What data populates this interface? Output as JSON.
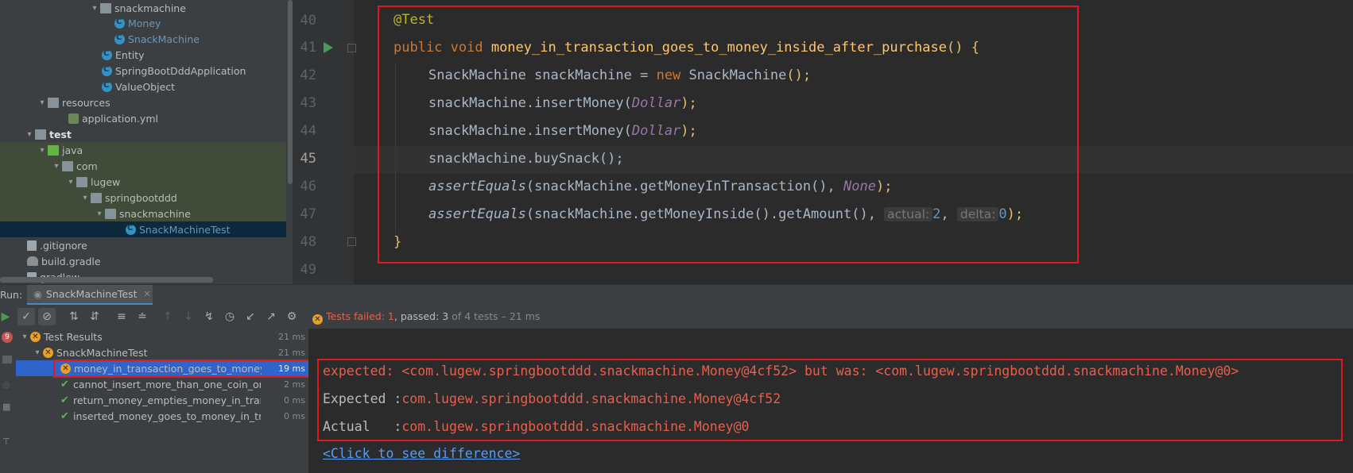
{
  "project_tree": {
    "items": [
      {
        "label": "snackmachine",
        "kind": "folder",
        "arrow": "v"
      },
      {
        "label": "Money",
        "kind": "class",
        "style": "blue"
      },
      {
        "label": "SnackMachine",
        "kind": "class",
        "style": "blue"
      },
      {
        "label": "Entity",
        "kind": "class",
        "style": ""
      },
      {
        "label": "SpringBootDddApplication",
        "kind": "class",
        "style": ""
      },
      {
        "label": "ValueObject",
        "kind": "class",
        "style": ""
      },
      {
        "label": "resources",
        "kind": "folder",
        "arrow": "v"
      },
      {
        "label": "application.yml",
        "kind": "yml",
        "style": ""
      },
      {
        "label": "test",
        "kind": "folder",
        "arrow": "v",
        "style": "bold"
      },
      {
        "label": "java",
        "kind": "folder-green",
        "arrow": "v"
      },
      {
        "label": "com",
        "kind": "folder",
        "arrow": "v"
      },
      {
        "label": "lugew",
        "kind": "folder",
        "arrow": "v"
      },
      {
        "label": "springbootddd",
        "kind": "folder",
        "arrow": "v"
      },
      {
        "label": "snackmachine",
        "kind": "folder",
        "arrow": "v"
      },
      {
        "label": "SnackMachineTest",
        "kind": "class",
        "style": "blue"
      },
      {
        "label": ".gitignore",
        "kind": "file",
        "style": ""
      },
      {
        "label": "build.gradle",
        "kind": "gradle",
        "style": ""
      },
      {
        "label": "gradlew",
        "kind": "file",
        "style": ""
      }
    ]
  },
  "editor": {
    "line_numbers": [
      "40",
      "41",
      "42",
      "43",
      "44",
      "45",
      "46",
      "47",
      "48",
      "49"
    ],
    "lines": {
      "l40": "@Test",
      "l41_kw": "public void ",
      "l41_fn": "money_in_transaction_goes_to_money_inside_after_purchase",
      "l41_end": "() {",
      "l42_a": "SnackMachine snackMachine = ",
      "l42_new": "new",
      "l42_b": " SnackMachine",
      "l42_c": "();",
      "l43_a": "snackMachine.insertMoney(",
      "l43_arg": "Dollar",
      "l43_c": ");",
      "l44_a": "snackMachine.insertMoney(",
      "l44_arg": "Dollar",
      "l44_c": ");",
      "l45": "snackMachine.buySnack();",
      "l46_fn": "assertEquals",
      "l46_a": "(snackMachine.getMoneyInTransaction(), ",
      "l46_arg": "None",
      "l46_c": ");",
      "l47_fn": "assertEquals",
      "l47_a": "(snackMachine.getMoneyInside().getAmount(), ",
      "l47_hint1": "actual:",
      "l47_v1": "2",
      "l47_sep": ", ",
      "l47_hint2": "delta:",
      "l47_v2": "0",
      "l47_c": ");",
      "l48": "}"
    }
  },
  "run": {
    "label": "Run:",
    "tab": "SnackMachineTest",
    "summary": {
      "failed": "Tests failed: 1",
      "passed": ", passed: 3",
      "rest": " of 4 tests – 21 ms"
    },
    "results": [
      {
        "label": "Test Results",
        "duration": "21 ms",
        "status": "fail"
      },
      {
        "label": "SnackMachineTest",
        "duration": "21 ms",
        "status": "fail"
      },
      {
        "label": "money_in_transaction_goes_to_money_inside_after_purchase",
        "duration": "19 ms",
        "status": "fail"
      },
      {
        "label": "cannot_insert_more_than_one_coin_or_note_at_a_time",
        "duration": "2 ms",
        "status": "pass"
      },
      {
        "label": "return_money_empties_money_in_transaction",
        "duration": "0 ms",
        "status": "pass"
      },
      {
        "label": "inserted_money_goes_to_money_in_transaction",
        "duration": "0 ms",
        "status": "pass"
      }
    ],
    "left_badge": "9",
    "console": {
      "line1": "expected: <com.lugew.springbootddd.snackmachine.Money@4cf52> but was: <com.lugew.springbootddd.snackmachine.Money@0>",
      "expected_label": "Expected :",
      "expected_value": "com.lugew.springbootddd.snackmachine.Money@4cf52",
      "actual_label": "Actual   :",
      "actual_value": "com.lugew.springbootddd.snackmachine.Money@0",
      "diff_link": "<Click to see difference>"
    }
  },
  "colors": {
    "accent_red": "#e0191e",
    "selection": "#2f65ca",
    "pass": "#5fb157",
    "fail": "#e5a02d"
  }
}
